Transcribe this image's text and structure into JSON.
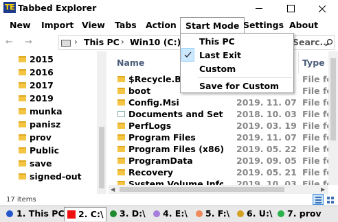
{
  "window": {
    "icon_text": "TE",
    "title": "Tabbed Explorer"
  },
  "menu": {
    "new": "New",
    "import": "Import",
    "view": "View",
    "tabs": "Tabs",
    "action": "Action",
    "start_mode": "Start Mode",
    "settings": "Settings",
    "about": "About"
  },
  "start_mode_menu": {
    "items": [
      "This PC",
      "Last Exit",
      "Custom",
      "Save for Custom"
    ],
    "checked": "Last Exit"
  },
  "address": {
    "crumbs": [
      "This PC",
      "Win10 (C:)"
    ],
    "separator": "›",
    "search_placeholder": "Searc..."
  },
  "tree": {
    "items": [
      "2015",
      "2016",
      "2017",
      "2019",
      "munka",
      "panisz",
      "prov",
      "Public",
      "save",
      "signed-out"
    ]
  },
  "list": {
    "columns": {
      "name": "Name",
      "type": "Type"
    },
    "rows": [
      {
        "name": "$Recycle.Bin",
        "date": "",
        "type": "File fo",
        "icon": "folder"
      },
      {
        "name": "boot",
        "date": "",
        "type": "File fo",
        "icon": "folder"
      },
      {
        "name": "Config.Msi",
        "date": "2019. 11. 07. ...",
        "type": "File fo",
        "icon": "folder"
      },
      {
        "name": "Documents and Settings",
        "date": "2018. 10. 03. ...",
        "type": "File fo",
        "icon": "shortcut"
      },
      {
        "name": "PerfLogs",
        "date": "2019. 03. 19. ...",
        "type": "File fo",
        "icon": "folder"
      },
      {
        "name": "Program Files",
        "date": "2019. 11. 07. ...",
        "type": "File fo",
        "icon": "folder"
      },
      {
        "name": "Program Files (x86)",
        "date": "2019. 05. 22. ...",
        "type": "File fo",
        "icon": "folder"
      },
      {
        "name": "ProgramData",
        "date": "2019. 09. 05. ...",
        "type": "File fo",
        "icon": "folder"
      },
      {
        "name": "Recovery",
        "date": "2019. 05. 21. ...",
        "type": "File fo",
        "icon": "folder"
      },
      {
        "name": "System Volume Information",
        "date": "2019. 10. 03. ...",
        "type": "File fo",
        "icon": "folder"
      }
    ]
  },
  "status": {
    "item_count": "17 items"
  },
  "drive_tabs": [
    {
      "label": "1. This PC",
      "color": "#2255cc",
      "shape": "dot"
    },
    {
      "label": "2. C:\\",
      "color": "#ee1111",
      "shape": "square",
      "active": true
    },
    {
      "label": "3. D:\\",
      "color": "#1e8a2e",
      "shape": "dot"
    },
    {
      "label": "4. E:\\",
      "color": "#a67ddb",
      "shape": "dot"
    },
    {
      "label": "5. F:\\",
      "color": "#f08a5a",
      "shape": "dot"
    },
    {
      "label": "6. U:\\",
      "color": "#d4a020",
      "shape": "dot"
    },
    {
      "label": "7. prov",
      "color": "#2bb24c",
      "shape": "dot"
    }
  ],
  "colors": {
    "column_header": "#4c5d7a",
    "folder": "#f4c542",
    "menu_highlight": "#cce8ff"
  }
}
